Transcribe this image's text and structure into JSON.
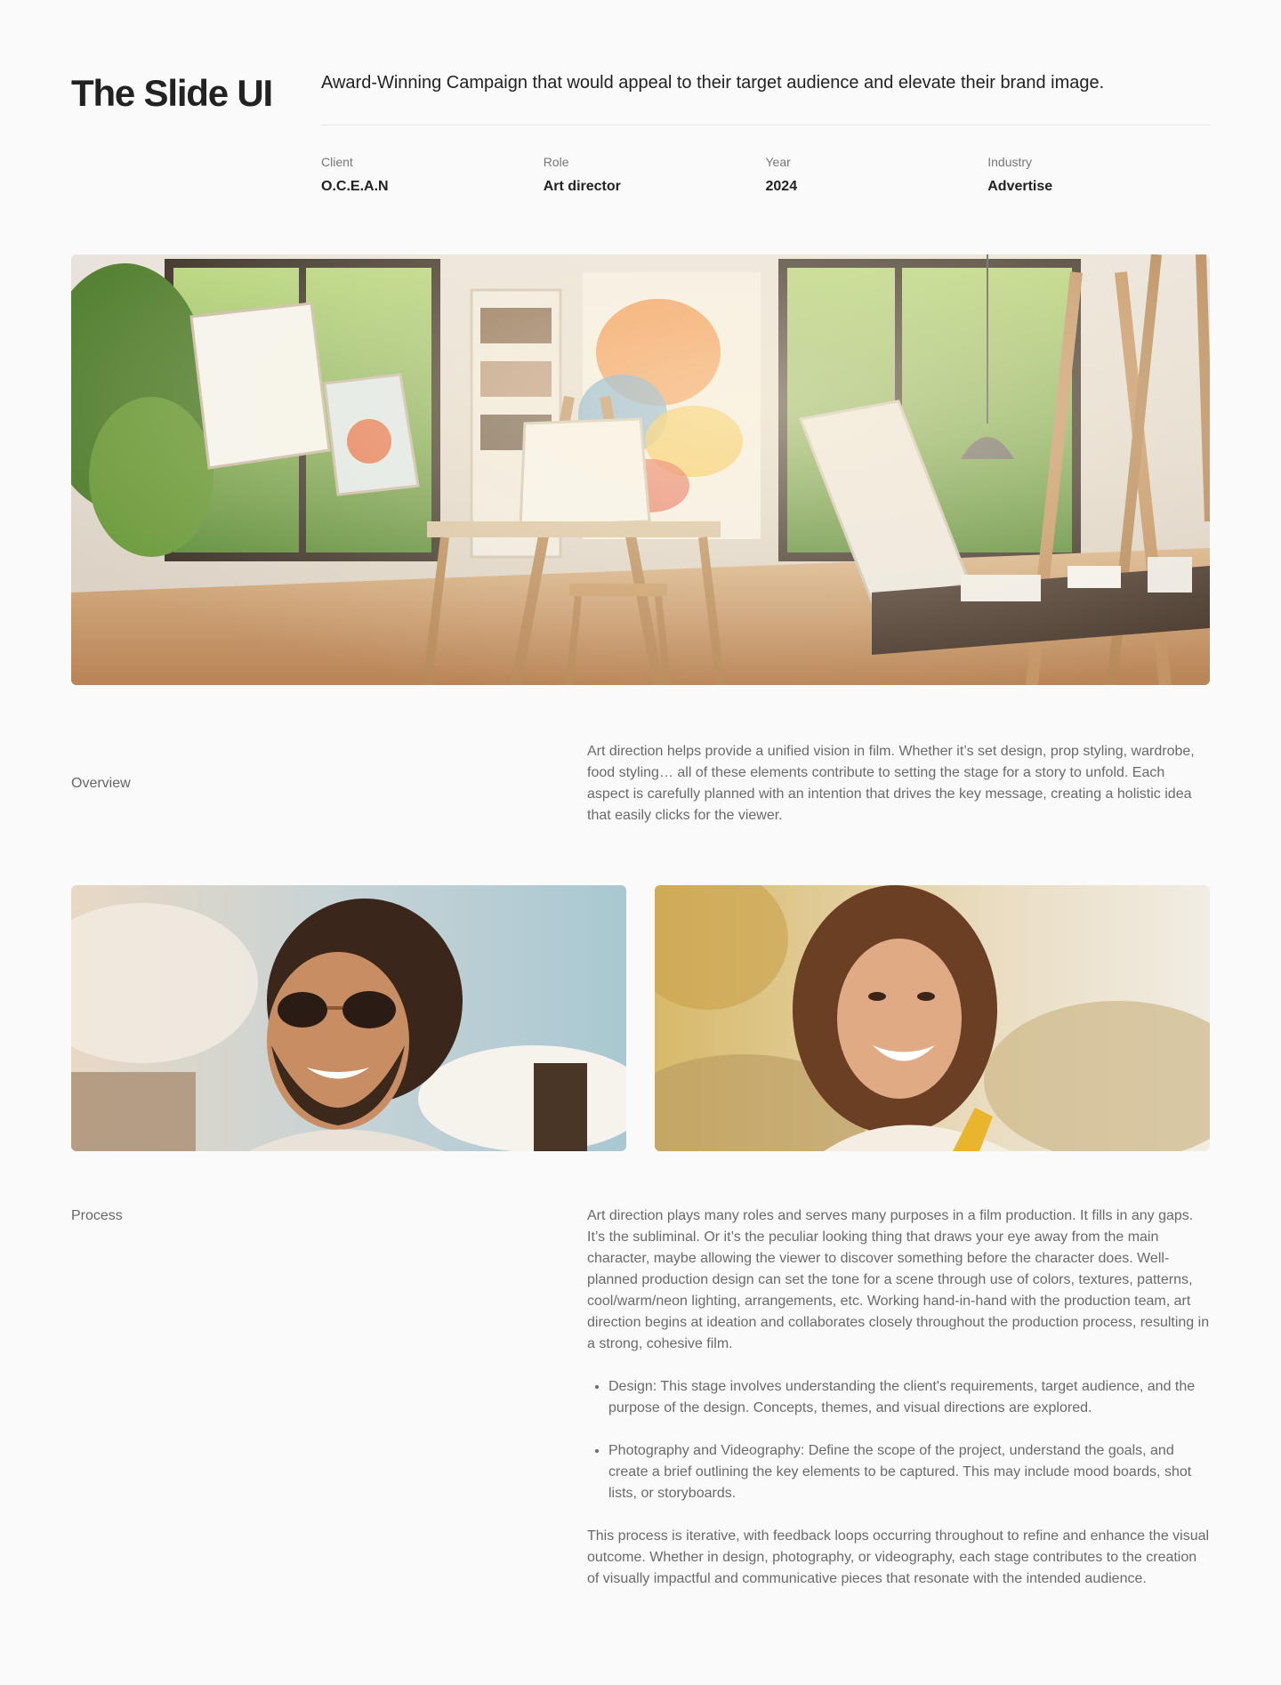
{
  "header": {
    "title": "The Slide UI",
    "tagline": "Award-Winning Campaign that would appeal to their target audience and elevate their brand image."
  },
  "meta": [
    {
      "label": "Client",
      "value": "O.C.E.A.N"
    },
    {
      "label": "Role",
      "value": "Art director"
    },
    {
      "label": "Year",
      "value": "2024"
    },
    {
      "label": "Industry",
      "value": "Advertise"
    }
  ],
  "overview": {
    "label": "Overview",
    "text": "Art direction helps provide a unified vision in film. Whether it’s set design, prop styling, wardrobe, food styling… all of these elements contribute to setting the stage for a story to unfold. Each aspect is carefully planned with an intention that drives the key message, creating a holistic idea that easily clicks for the viewer."
  },
  "process": {
    "label": "Process",
    "intro": "Art direction plays many roles and serves many purposes in a film production. It fills in any gaps. It’s the subliminal. Or it’s the peculiar looking thing that draws your eye away from the main character, maybe allowing the viewer to discover something before the character does. Well-planned production design can set the tone for a scene through use of colors, textures, patterns, cool/warm/neon lighting, arrangements, etc. Working hand-in-hand with the production team, art direction begins at ideation and collaborates closely throughout the production process, resulting in a strong, cohesive film.",
    "bullets": [
      "Design: This stage involves understanding the client's requirements, target audience, and the purpose of the design. Concepts, themes, and visual directions are explored.",
      "Photography and Videography: Define the scope of the project, understand the goals, and create a brief outlining the key elements to be captured. This may include mood boards, shot lists, or storyboards."
    ],
    "outro": "This process is iterative, with feedback loops occurring throughout to refine and enhance the visual outcome. Whether in design, photography, or videography, each stage contributes to the creation of visually impactful and communicative pieces that resonate with the intended audience."
  }
}
